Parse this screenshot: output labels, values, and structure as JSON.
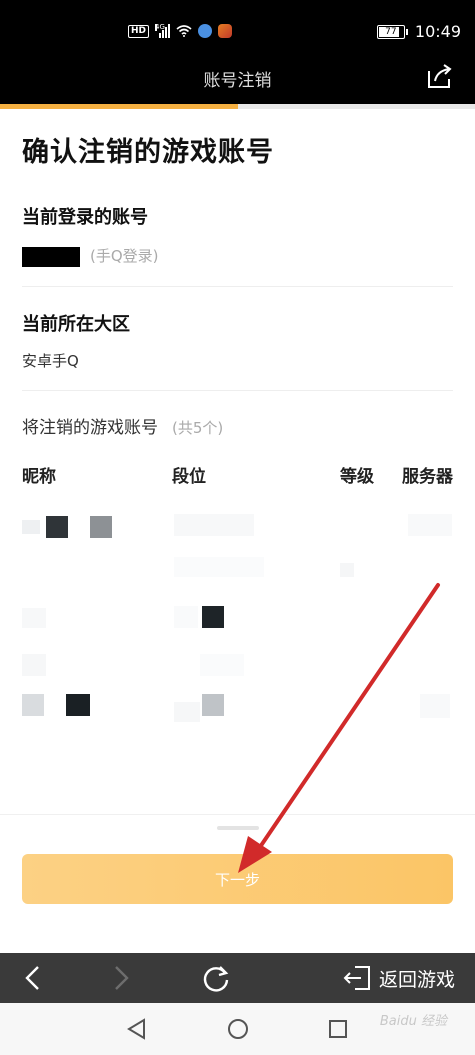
{
  "status_bar": {
    "hd": "HD",
    "network": "4G",
    "battery_level": "77",
    "time": "10:49",
    "icons": [
      "hd-badge",
      "signal-icon",
      "wifi-icon",
      "browser-app-icon",
      "game-app-icon",
      "battery-icon"
    ]
  },
  "header": {
    "title": "账号注销",
    "share_icon": "share-icon",
    "progress": 0.5
  },
  "page": {
    "title": "确认注销的游戏账号",
    "current_account_label": "当前登录的账号",
    "current_account_hint": "(手Q登录)",
    "current_region_label": "当前所在大区",
    "current_region_value": "安卓手Q",
    "accounts_label": "将注销的游戏账号",
    "accounts_count": "(共5个)",
    "table_headers": {
      "nickname": "昵称",
      "rank": "段位",
      "level": "等级",
      "server": "服务器"
    }
  },
  "action": {
    "next_label": "下一步"
  },
  "toolbar": {
    "back_icon": "chevron-left-icon",
    "forward_icon": "chevron-right-icon",
    "refresh_icon": "refresh-icon",
    "return_label": "返回游戏",
    "return_icon": "exit-icon"
  },
  "navbar": {
    "back_icon": "nav-back-icon",
    "home_icon": "nav-home-icon",
    "recent_icon": "nav-recent-icon"
  },
  "watermark": "Baidu 经验",
  "colors": {
    "accent": "#f5b041",
    "button": "#fbc566",
    "arrow": "#d12a2a",
    "toolbar": "#3a3a3a"
  }
}
